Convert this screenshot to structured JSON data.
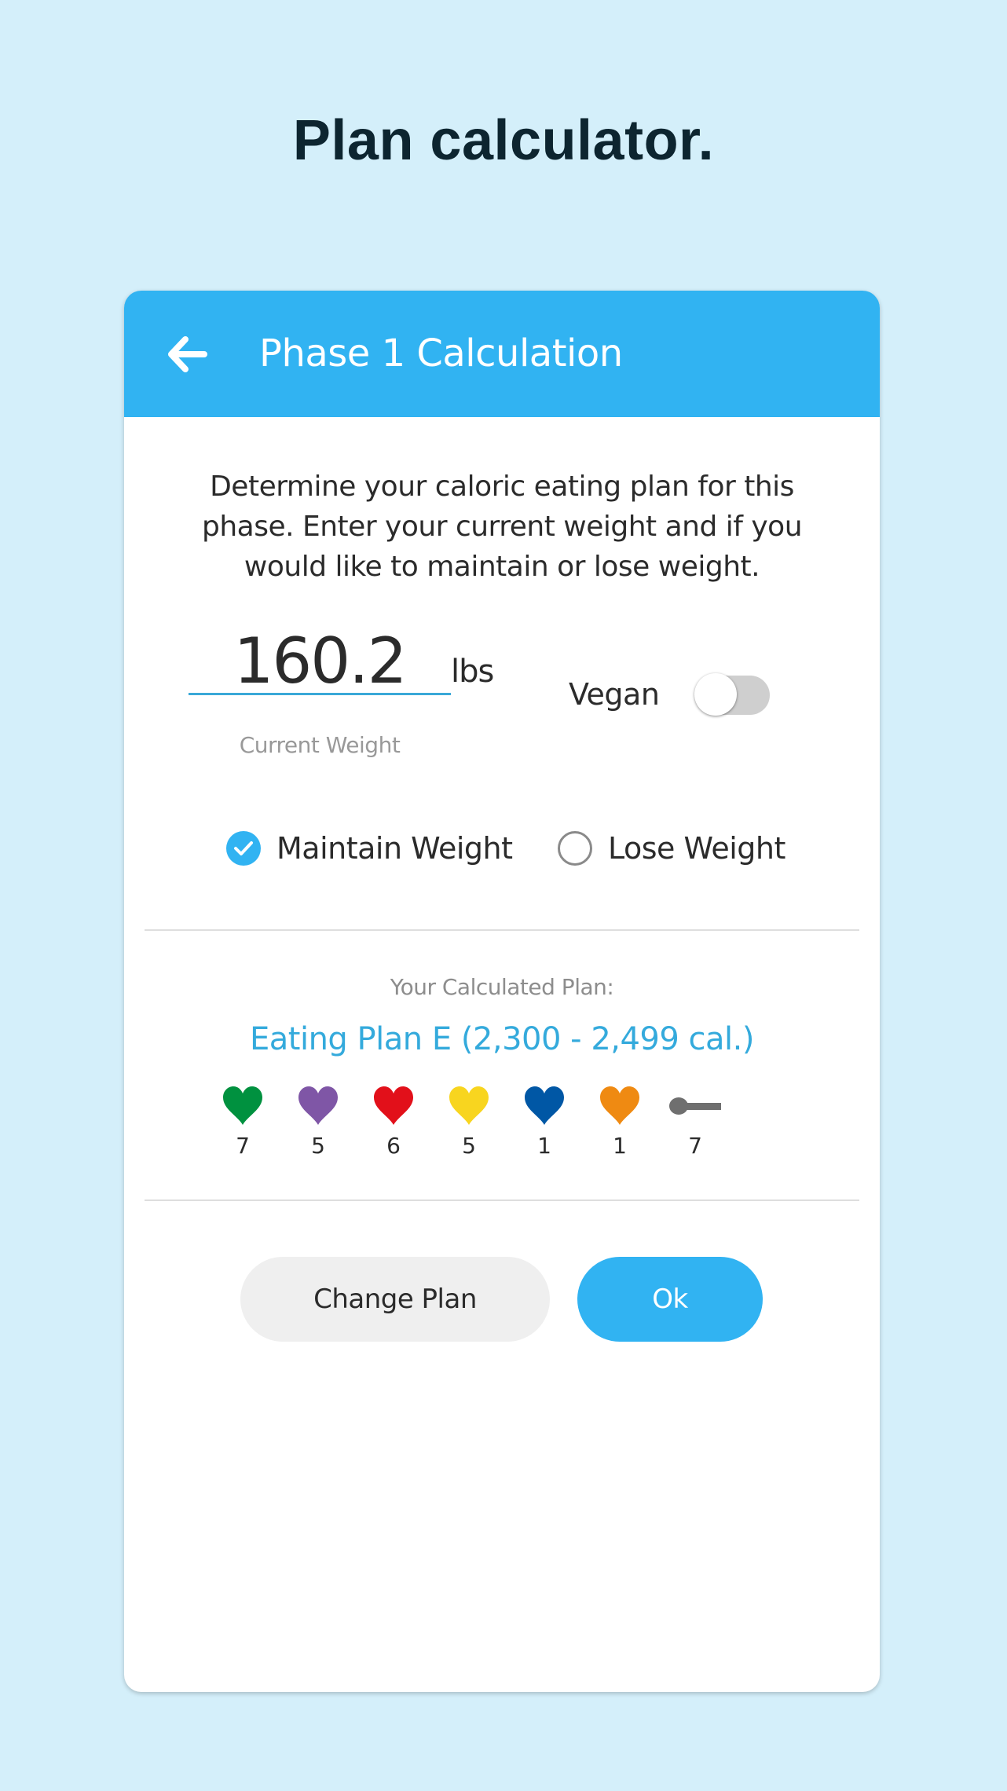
{
  "page": {
    "title": "Plan calculator."
  },
  "header": {
    "back_icon": "arrow-left-icon",
    "title": "Phase 1 Calculation",
    "color": "#31b3f2"
  },
  "intro": {
    "description": "Determine your caloric eating plan for this phase. Enter your current weight and if you would like to maintain or lose weight."
  },
  "weight": {
    "value": "160.2",
    "unit": "lbs",
    "label": "Current Weight"
  },
  "vegan": {
    "label": "Vegan",
    "enabled": false
  },
  "goal": {
    "options": [
      {
        "label": "Maintain Weight",
        "selected": true
      },
      {
        "label": "Lose Weight",
        "selected": false
      }
    ]
  },
  "plan": {
    "caption": "Your Calculated Plan:",
    "name": "Eating Plan E (2,300 - 2,499 cal.)",
    "servings": [
      {
        "icon": "heart-icon",
        "color": "#00913f",
        "count": "7"
      },
      {
        "icon": "heart-icon",
        "color": "#7f56a6",
        "count": "5"
      },
      {
        "icon": "heart-icon",
        "color": "#e2101a",
        "count": "6"
      },
      {
        "icon": "heart-icon",
        "color": "#f8d51f",
        "count": "5"
      },
      {
        "icon": "heart-icon",
        "color": "#0057a5",
        "count": "1"
      },
      {
        "icon": "heart-icon",
        "color": "#ef8a12",
        "count": "1"
      },
      {
        "icon": "spoon-icon",
        "color": "#6f6f6f",
        "count": "7"
      }
    ]
  },
  "actions": {
    "change_plan_label": "Change Plan",
    "ok_label": "Ok"
  }
}
